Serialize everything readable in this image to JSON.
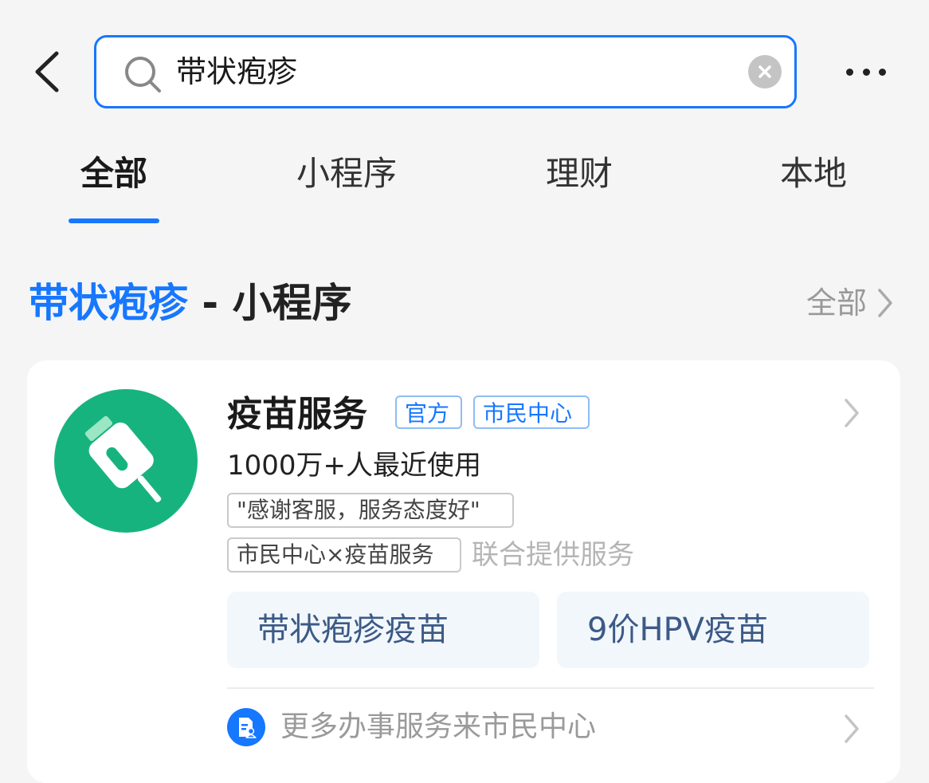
{
  "search": {
    "query": "带状疱疹"
  },
  "tabs": [
    {
      "label": "全部"
    },
    {
      "label": "小程序"
    },
    {
      "label": "理财"
    },
    {
      "label": "本地"
    }
  ],
  "section": {
    "keyword": "带状疱疹",
    "separator": " - ",
    "category": "小程序",
    "all_label": "全部"
  },
  "result": {
    "app_name": "疫苗服务",
    "tags": [
      "官方",
      "市民中心"
    ],
    "usage": "1000万+人最近使用",
    "review_quote": "\"感谢客服，服务态度好\"",
    "joint_tag": "市民中心×疫苗服务",
    "joint_note": "联合提供服务",
    "quick_links": [
      "带状疱疹疫苗",
      "9价HPV疫苗"
    ],
    "more_service": "更多办事服务来市民中心"
  },
  "colors": {
    "accent": "#1677ff",
    "logo_bg": "#17b37e",
    "quick_link_bg": "#f2f7fc",
    "quick_link_text": "#3c5a86"
  }
}
